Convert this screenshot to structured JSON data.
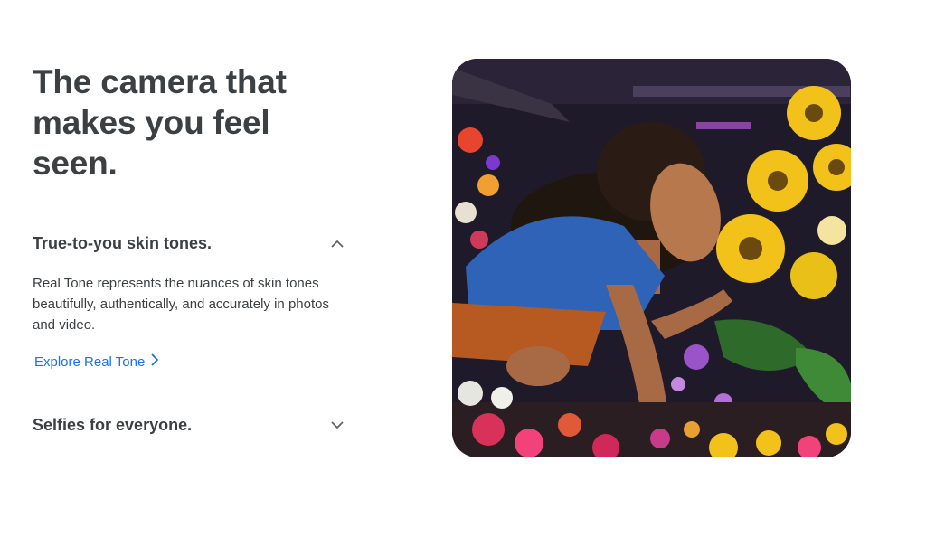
{
  "headline": {
    "line1": "The camera that",
    "line2": "makes you feel",
    "line3": "seen."
  },
  "accordion": {
    "items": [
      {
        "title": "True-to-you skin tones.",
        "expanded": true,
        "icon": "chevron-up-icon",
        "body": "Real Tone represents the nuances of skin tones beautifully, authentically, and accurately in photos and video.",
        "link_label": "Explore Real Tone",
        "link_icon": "chevron-right-icon"
      },
      {
        "title": "Selfies for everyone.",
        "expanded": false,
        "icon": "chevron-down-icon"
      }
    ]
  },
  "hero_image": {
    "subject": "woman smelling sunflowers in flower shop"
  },
  "colors": {
    "heading": "#3c4043",
    "link": "#1a73e8",
    "background": "#ffffff"
  }
}
